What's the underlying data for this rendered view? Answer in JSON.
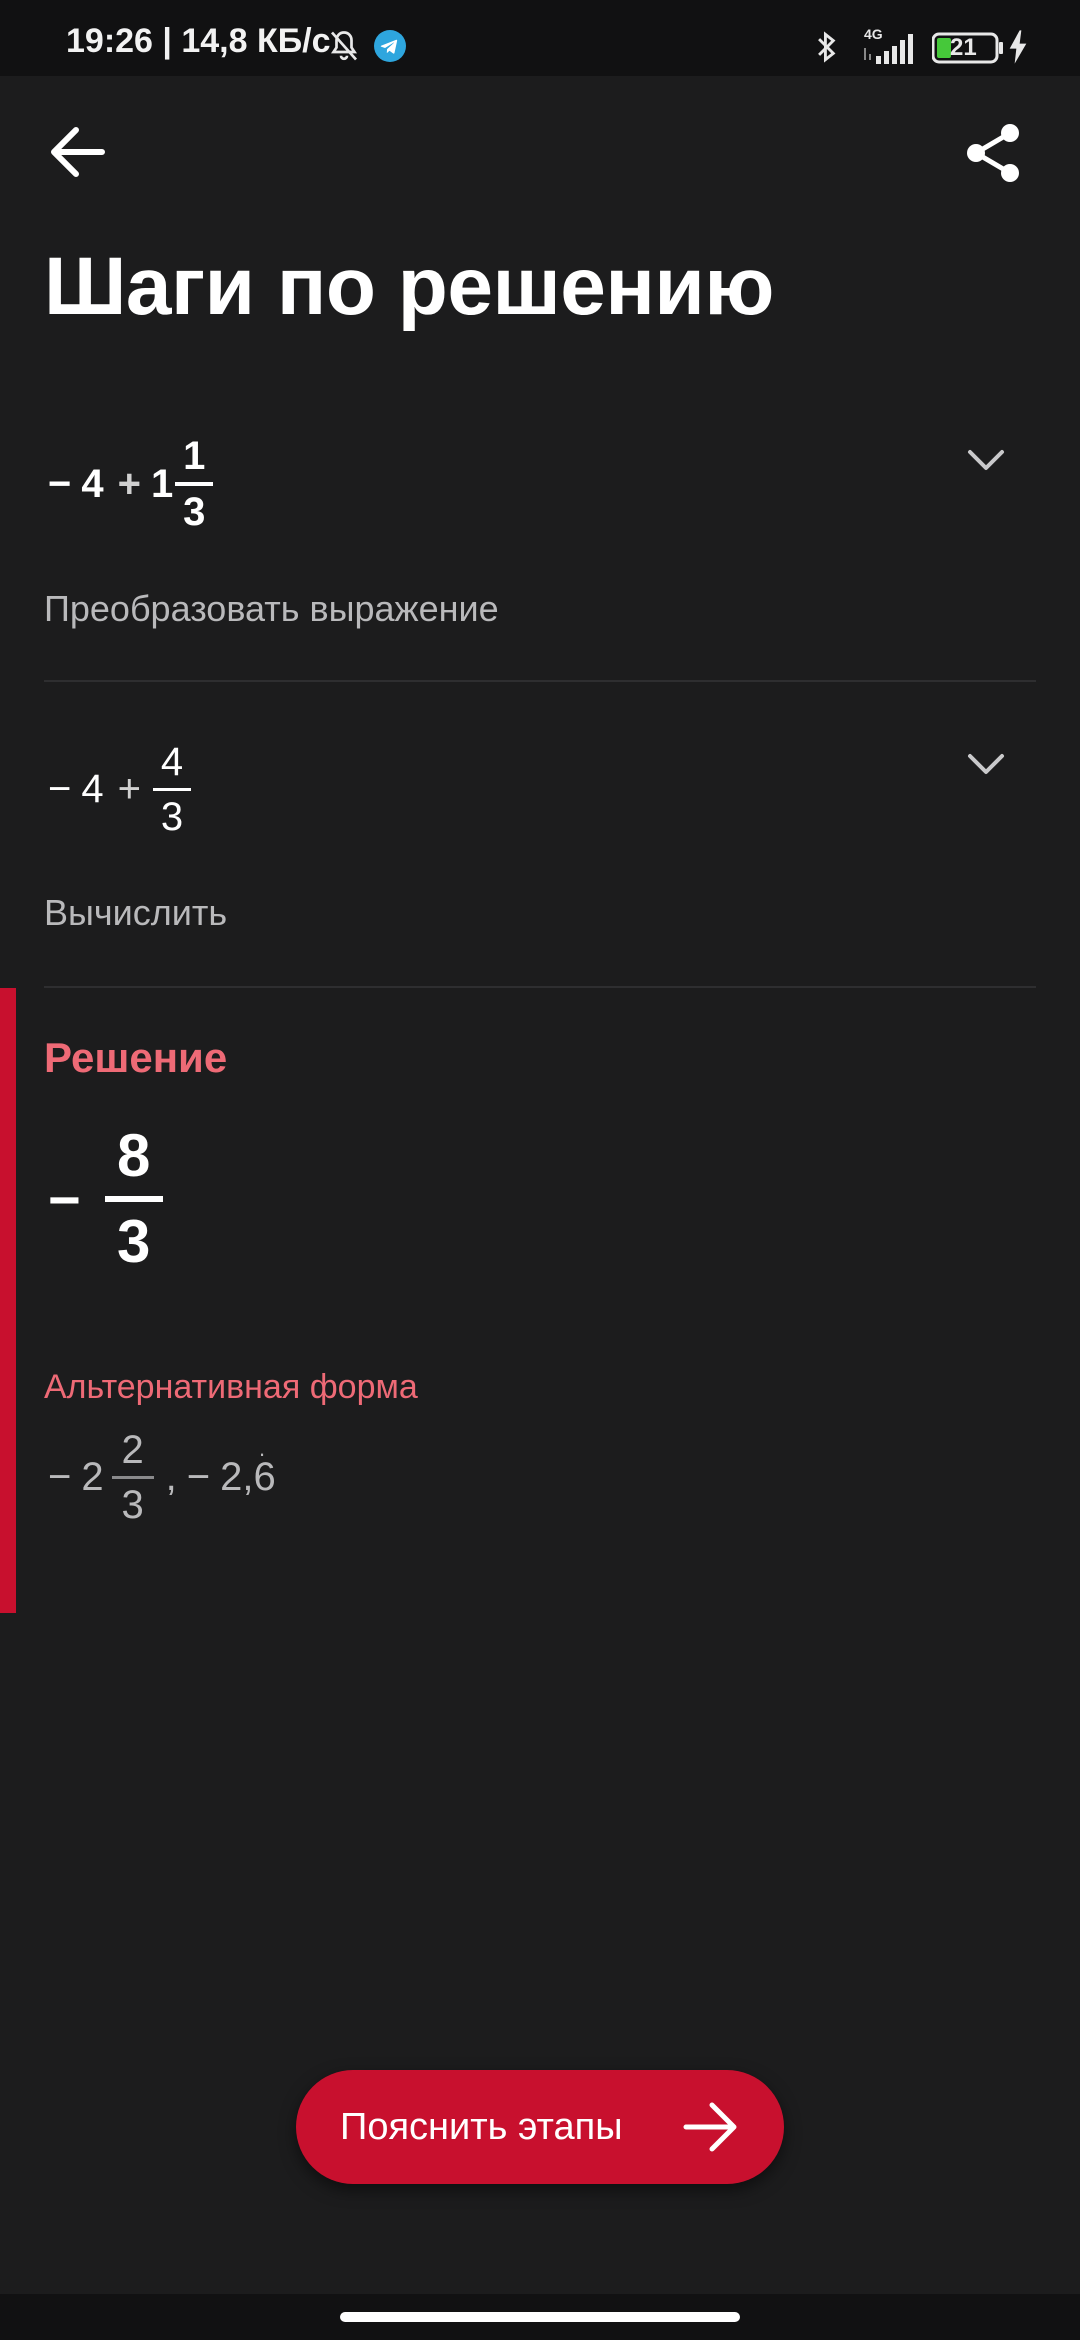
{
  "status_bar": {
    "time_speed": "19:26 | 14,8 КБ/с",
    "network": "4G",
    "battery": "21"
  },
  "header": {
    "title": "Шаги по решению"
  },
  "steps": [
    {
      "expression": {
        "sign": "−",
        "whole": "4",
        "op": "+",
        "mixed_whole": "1",
        "numerator": "1",
        "denominator": "3"
      },
      "label": "Преобразовать выражение"
    },
    {
      "expression": {
        "sign": "−",
        "whole": "4",
        "op": "+",
        "numerator": "4",
        "denominator": "3"
      },
      "label": "Вычислить"
    }
  ],
  "solution": {
    "title": "Решение",
    "sign": "−",
    "numerator": "8",
    "denominator": "3",
    "alt_title": "Альтернативная форма",
    "alt": {
      "sign": "−",
      "whole": "2",
      "numerator": "2",
      "denominator": "3",
      "separator": ",",
      "decimal_sign": "−",
      "decimal": "2,6"
    }
  },
  "cta": {
    "label": "Пояснить этапы"
  },
  "colors": {
    "accent": "#c8102e",
    "accent_text": "#ee6a76",
    "background": "#1c1c1d"
  }
}
